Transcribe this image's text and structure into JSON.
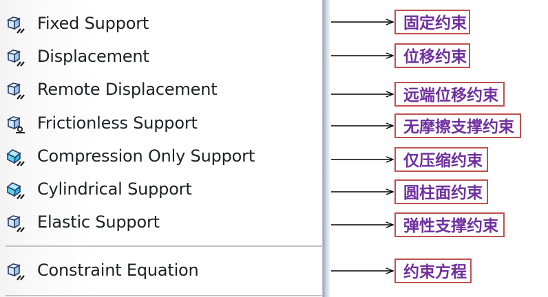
{
  "menu": {
    "items": [
      {
        "label": "Fixed Support",
        "icon": "fixed-support-icon"
      },
      {
        "label": "Displacement",
        "icon": "displacement-icon"
      },
      {
        "label": "Remote Displacement",
        "icon": "remote-displacement-icon"
      },
      {
        "label": "Frictionless Support",
        "icon": "frictionless-support-icon"
      },
      {
        "label": "Compression Only Support",
        "icon": "compression-only-support-icon"
      },
      {
        "label": "Cylindrical Support",
        "icon": "cylindrical-support-icon"
      },
      {
        "label": "Elastic Support",
        "icon": "elastic-support-icon"
      },
      {
        "label": "Constraint Equation",
        "icon": "constraint-equation-icon"
      }
    ]
  },
  "annotations": [
    "固定约束",
    "位移约束",
    "远端位移约束",
    "无摩擦支撑约束",
    "仅压缩约束",
    "圆柱面约束",
    "弹性支撑约束",
    "约束方程"
  ],
  "colors": {
    "annotation_border": "#c0504d",
    "annotation_text": "#7030a0",
    "icon_face": "#cfe8ff",
    "icon_face_cyan": "#5fd3f3",
    "icon_stroke": "#2b3d63"
  }
}
